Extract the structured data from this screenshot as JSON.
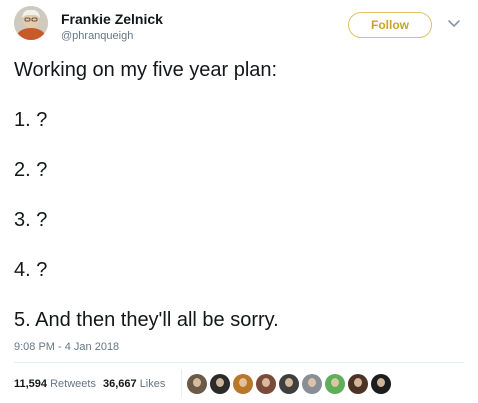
{
  "author": {
    "display_name": "Frankie Zelnick",
    "handle": "@phranqueigh",
    "avatar_icon": "profile-photo-icon"
  },
  "actions": {
    "follow_label": "Follow",
    "follow_color": "#c9a227",
    "menu_icon": "chevron-down-icon"
  },
  "tweet": {
    "lines": [
      "Working on my five year plan:",
      "1. ?",
      "2. ?",
      "3. ?",
      "4. ?",
      "5. And then they'll all be sorry."
    ],
    "timestamp": "9:08 PM - 4 Jan 2018"
  },
  "stats": {
    "retweets_count": "11,594",
    "retweets_label": "Retweets",
    "likes_count": "36,667",
    "likes_label": "Likes"
  },
  "likers": [
    {
      "icon": "liker-avatar-icon",
      "color": "#6b5a48"
    },
    {
      "icon": "liker-avatar-icon",
      "color": "#2b2b2b"
    },
    {
      "icon": "liker-avatar-icon",
      "color": "#b9772a"
    },
    {
      "icon": "liker-avatar-icon",
      "color": "#7a4a3a"
    },
    {
      "icon": "liker-avatar-icon",
      "color": "#3f3f3f"
    },
    {
      "icon": "liker-avatar-icon",
      "color": "#8a8f96"
    },
    {
      "icon": "liker-avatar-icon",
      "color": "#5fae5a"
    },
    {
      "icon": "liker-avatar-icon",
      "color": "#4d3326"
    },
    {
      "icon": "liker-avatar-icon",
      "color": "#1d1d1d"
    }
  ]
}
